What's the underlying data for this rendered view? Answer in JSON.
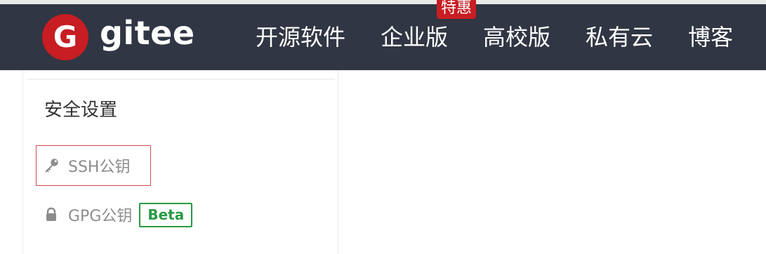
{
  "colors": {
    "navbar_bg": "#303643",
    "brand_red": "#c71d23",
    "text_dark": "#333333",
    "text_muted": "#8c8c8c",
    "beta_green": "#2a9a45"
  },
  "header": {
    "brand": "gitee",
    "logo_letter": "G",
    "nav": [
      {
        "label": "开源软件"
      },
      {
        "label": "企业版",
        "badge": "特惠"
      },
      {
        "label": "高校版"
      },
      {
        "label": "私有云"
      },
      {
        "label": "博客"
      }
    ]
  },
  "sidebar": {
    "section_title": "安全设置",
    "items": [
      {
        "label": "SSH公钥",
        "icon": "key-icon"
      },
      {
        "label": "GPG公钥",
        "icon": "lock-icon",
        "badge": "Beta"
      }
    ]
  }
}
